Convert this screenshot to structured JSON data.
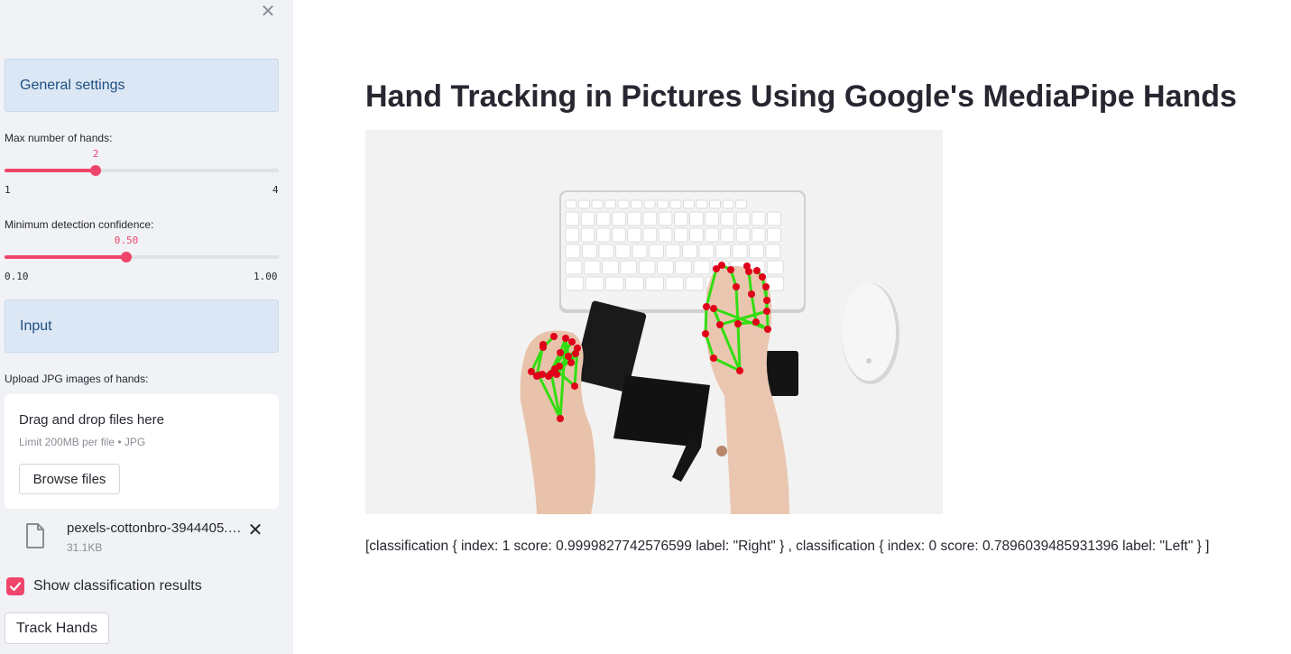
{
  "sidebar": {
    "close_icon": "close-icon",
    "general_settings": "General settings",
    "max_hands": {
      "label": "Max number of hands:",
      "value": "2",
      "min": "1",
      "max": "4",
      "fraction": 0.3333
    },
    "min_conf": {
      "label": "Minimum detection confidence:",
      "value": "0.50",
      "min": "0.10",
      "max": "1.00",
      "fraction": 0.4444
    },
    "input_section": "Input",
    "upload_label": "Upload JPG images of hands:",
    "dropzone": {
      "title": "Drag and drop files here",
      "subtitle": "Limit 200MB per file • JPG",
      "browse_label": "Browse files"
    },
    "file": {
      "name": "pexels-cottonbro-3944405.jpg",
      "size": "31.1KB",
      "icon": "file-icon"
    },
    "show_classification": {
      "label": "Show classification results",
      "checked": true
    },
    "track_button": "Track Hands"
  },
  "main": {
    "title": "Hand Tracking in Pictures Using Google's MediaPipe Hands",
    "result_text": "[classification { index: 1 score: 0.9999827742576599 label: \"Right\" } , classification { index: 0 score: 0.7896039485931396 label: \"Left\" } ]"
  },
  "colors": {
    "accent": "#f0456b",
    "sidebar_bg": "#f0f2f6",
    "expander_bg": "#dbe7f4",
    "landmark": "#e0001a",
    "connection": "#33dd11"
  }
}
